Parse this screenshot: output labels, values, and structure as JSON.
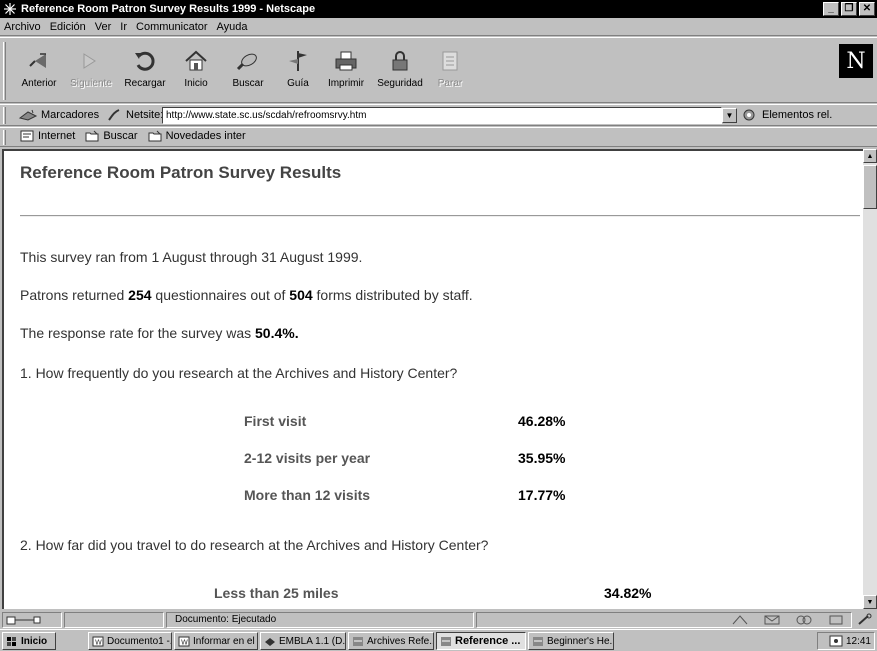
{
  "window": {
    "title": "Reference Room Patron Survey Results 1999 - Netscape"
  },
  "menu": [
    "Archivo",
    "Edición",
    "Ver",
    "Ir",
    "Communicator",
    "Ayuda"
  ],
  "toolbar": {
    "buttons": [
      {
        "label": "Anterior",
        "icon": "back-arrow-icon",
        "enabled": true
      },
      {
        "label": "Siguiente",
        "icon": "forward-arrow-icon",
        "enabled": false
      },
      {
        "label": "Recargar",
        "icon": "reload-icon",
        "enabled": true
      },
      {
        "label": "Inicio",
        "icon": "home-icon",
        "enabled": true
      },
      {
        "label": "Buscar",
        "icon": "search-icon",
        "enabled": true
      },
      {
        "label": "Guía",
        "icon": "guide-icon",
        "enabled": true
      },
      {
        "label": "Imprimir",
        "icon": "print-icon",
        "enabled": true
      },
      {
        "label": "Seguridad",
        "icon": "security-lock-icon",
        "enabled": true
      },
      {
        "label": "Parar",
        "icon": "stop-icon",
        "enabled": false
      }
    ],
    "logo": "N"
  },
  "location": {
    "bookmarks_label": "Marcadores",
    "netsite_label": "Netsite:",
    "url": "http://www.state.sc.us/scdah/refroomsrvy.htm",
    "related_label": "Elementos rel."
  },
  "personal_toolbar": [
    "Internet",
    "Buscar",
    "Novedades inter"
  ],
  "page": {
    "title": "Reference Room Patron Survey Results",
    "survey_period": "This survey ran from 1 August through 31 August 1999.",
    "returned": {
      "prefix": "Patrons returned ",
      "returned_count": "254",
      "middle": " questionnaires out of ",
      "distributed_count": "504",
      "suffix": " forms distributed by staff."
    },
    "response_rate": {
      "prefix": "The response rate for the survey was ",
      "value": "50.4%."
    },
    "q1": {
      "question": "1. How frequently do you research at the Archives and History Center?",
      "answers": [
        {
          "label": "First visit",
          "value": "46.28%"
        },
        {
          "label": "2-12 visits per year",
          "value": "35.95%"
        },
        {
          "label": "More than 12 visits",
          "value": "17.77%"
        }
      ]
    },
    "q2": {
      "question": "2. How far did you travel to do research at the Archives and History Center?",
      "answers": [
        {
          "label": "Less than 25 miles",
          "value": "34.82%"
        }
      ]
    }
  },
  "status": {
    "text": "Documento: Ejecutado"
  },
  "taskbar": {
    "start_label": "Inicio",
    "tasks": [
      {
        "label": "Documento1 -...",
        "icon": "word-doc-icon",
        "active": false
      },
      {
        "label": "Informar en el ...",
        "icon": "word-doc-icon",
        "active": false
      },
      {
        "label": "EMBLA 1.1 (D...",
        "icon": "app-icon",
        "active": false
      },
      {
        "label": "Archives Refe...",
        "icon": "netscape-icon",
        "active": false
      },
      {
        "label": "Reference ...",
        "icon": "netscape-icon",
        "active": true
      },
      {
        "label": "Beginner's He...",
        "icon": "netscape-icon",
        "active": false
      }
    ],
    "clock": "12:41"
  },
  "colors": {
    "window_face": "#c0c0c0",
    "titlebar": "#000000",
    "page_background": "#ffffff"
  }
}
